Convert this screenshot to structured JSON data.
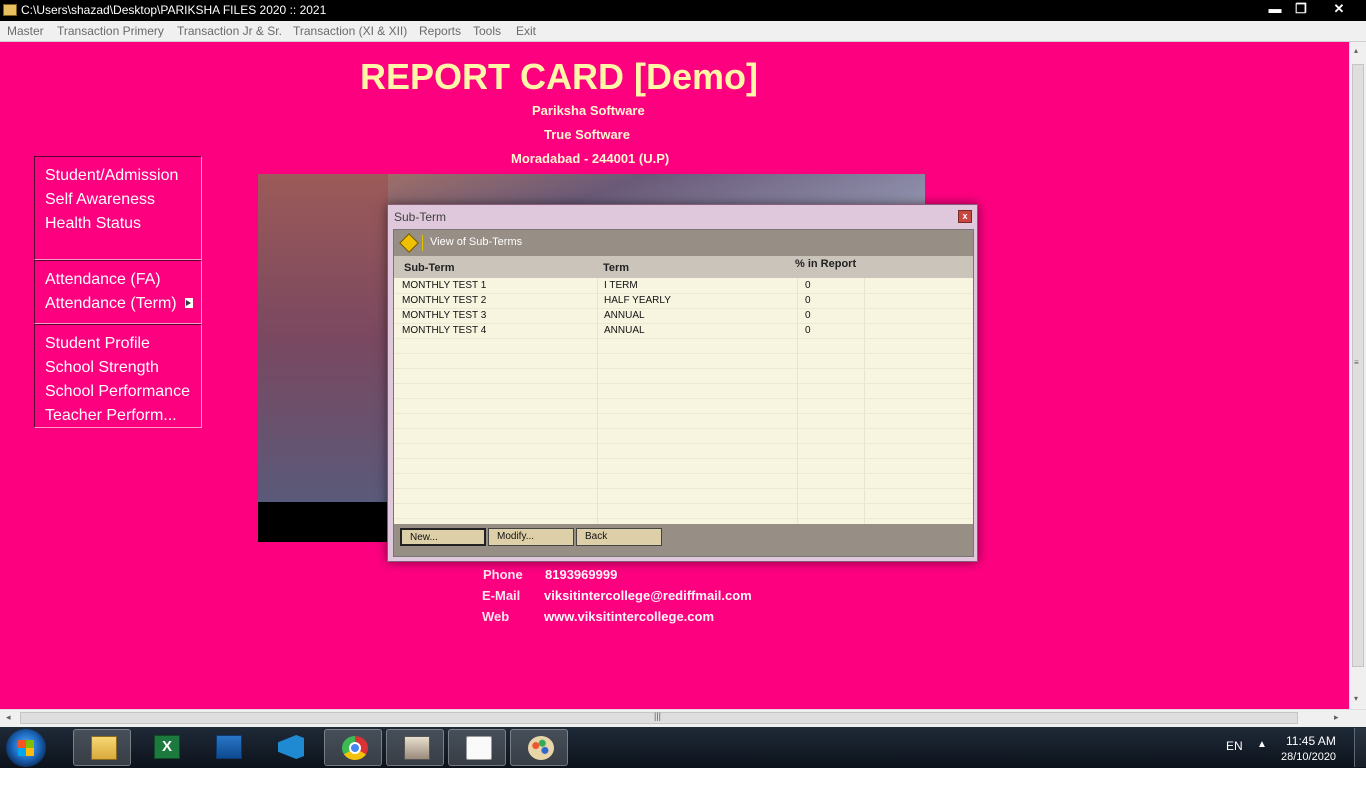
{
  "window": {
    "title": "C:\\Users\\shazad\\Desktop\\PARIKSHA FILES 2020 :: 2021",
    "min_glyph": "▬",
    "max_glyph": "❐",
    "close_glyph": "✕"
  },
  "menu": [
    "Master",
    "Transaction Primery",
    "Transaction Jr & Sr.",
    "Transaction (XI & XII)",
    "Reports",
    "Tools",
    "Exit"
  ],
  "header": {
    "title": "REPORT CARD [Demo]",
    "line1": "Pariksha Software",
    "line2": "True Software",
    "line3": "Moradabad - 244001 (U.P)"
  },
  "left_menu": {
    "group1": [
      "Student/Admission",
      "Self Awareness",
      "Health Status"
    ],
    "group2": [
      "Attendance (FA)",
      "Attendance (Term)"
    ],
    "group3": [
      "Student Profile",
      "School Strength",
      "School Performance",
      "Teacher Perform..."
    ]
  },
  "contact": {
    "phone_label": "Phone",
    "phone": "8193969999",
    "email_label": "E-Mail",
    "email": "viksitintercollege@rediffmail.com",
    "web_label": "Web",
    "web": "www.viksitintercollege.com"
  },
  "dialog": {
    "title": "Sub-Term",
    "close_glyph": "x",
    "header": "View of Sub-Terms",
    "columns": [
      "Sub-Term",
      "Term",
      "% in Report"
    ],
    "rows": [
      {
        "sub_term": "MONTHLY TEST 1",
        "term": "I TERM",
        "pct": "0"
      },
      {
        "sub_term": "MONTHLY TEST 2",
        "term": "HALF YEARLY",
        "pct": "0"
      },
      {
        "sub_term": "MONTHLY TEST 3",
        "term": "ANNUAL",
        "pct": "0"
      },
      {
        "sub_term": "MONTHLY TEST 4",
        "term": "ANNUAL",
        "pct": "0"
      }
    ],
    "buttons": {
      "new": "New...",
      "modify": "Modify...",
      "back": "Back"
    }
  },
  "scroll": {
    "grip": "|||",
    "left": "◂",
    "right": "▸",
    "up": "▴",
    "down": "▾"
  },
  "taskbar": {
    "apps": [
      "file-explorer-icon",
      "excel-icon",
      "app-icon",
      "vscode-icon",
      "chrome-icon",
      "app-icon",
      "folder-icon",
      "paint-icon"
    ],
    "lang": "EN",
    "up_glyph": "▲",
    "time": "11:45 AM",
    "date": "28/10/2020"
  }
}
